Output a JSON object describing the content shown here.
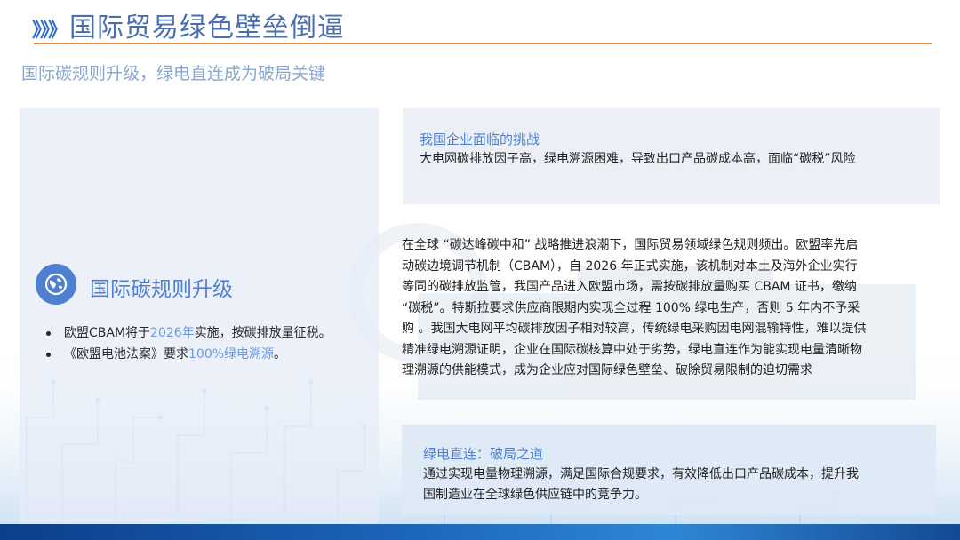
{
  "title": {
    "chevrons": "》》》",
    "text": "国际贸易绿色壁垒倒逼"
  },
  "subtitle": "国际碳规则升级，绿电直连成为破局关键",
  "left": {
    "heading": "国际碳规则升级",
    "bullets": [
      {
        "pre": "欧盟CBAM将于",
        "hl": "2026年",
        "post": "实施，按碳排放量征税。"
      },
      {
        "pre": "《欧盟电池法案》要求",
        "hl": "100%绿电溯源",
        "post": "。"
      }
    ]
  },
  "challenge": {
    "title": "我国企业面临的挑战",
    "text": "大电网碳排放因子高，绿电溯源困难，导致出口产品碳成本高，面临“碳税”风险"
  },
  "body": {
    "lines": [
      "在全球 “碳达峰碳中和” 战略推进浪潮下，国际贸易领域绿色规则频出。欧盟率先启",
      "动碳边境调节机制（CBAM），自 2026 年正式实施，该机制对本土及海外企业实行",
      "等同的碳排放监管，我国产品进入欧盟市场，需按碳排放量购买 CBAM 证书，缴纳",
      "  “碳税”。特斯拉要求供应商限期内实现全过程 100% 绿电生产，否则 5 年内不予采",
      "购 。我国大电网平均碳排放因子相对较高，传统绿电采购因电网混输特性，难以提供",
      "精准绿电溯源证明，企业在国际碳核算中处于劣势，绿电直连作为能实现电量清晰物",
      "理溯源的供能模式，成为企业应对国际绿色壁垒、破除贸易限制的迫切需求"
    ]
  },
  "solution": {
    "title": "绿电直连：破局之道",
    "lines": [
      "通过实现电量物理溯源，满足国际合规要求，有效降低出口产品碳成本，提升我",
      "国制造业在全球绿色供应链中的竞争力。"
    ]
  },
  "colors": {
    "accent": "#4e7fd0",
    "title_line": "#e8873e",
    "highlight": "#6c9be0"
  }
}
